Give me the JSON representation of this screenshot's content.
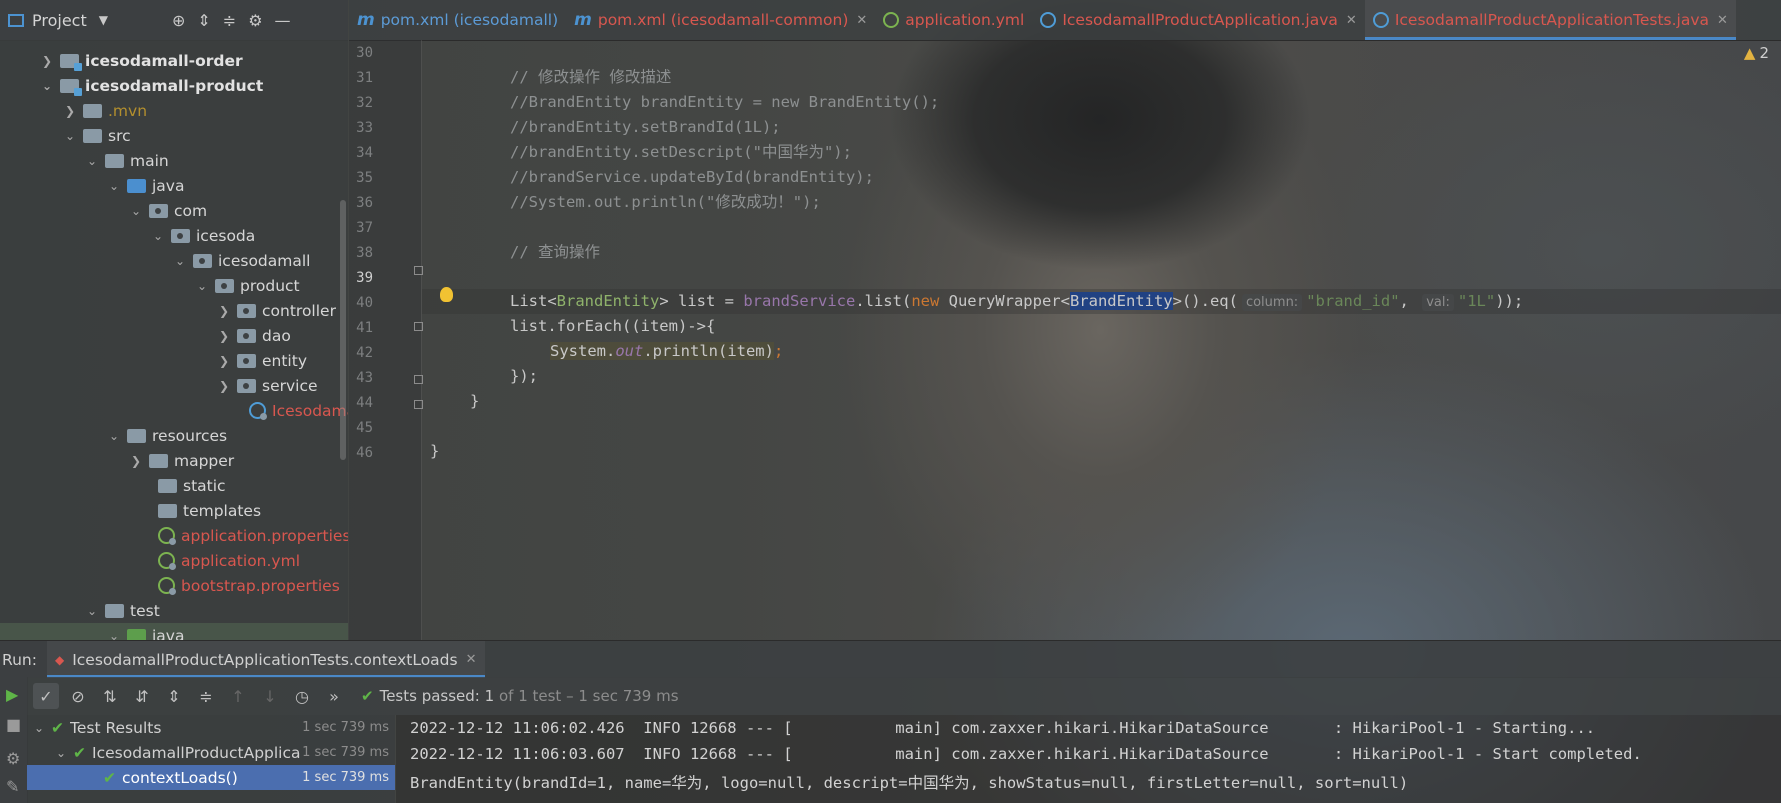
{
  "project_panel": {
    "title": "Project",
    "tree": [
      {
        "label": "icesodamall-order",
        "kind": "module",
        "depth": 0,
        "expanded": false
      },
      {
        "label": "icesodamall-product",
        "kind": "module",
        "depth": 0,
        "expanded": true
      },
      {
        "label": ".mvn",
        "kind": "folder",
        "depth": 1,
        "expanded": false
      },
      {
        "label": "src",
        "kind": "folder",
        "depth": 1,
        "expanded": true
      },
      {
        "label": "main",
        "kind": "folder",
        "depth": 2,
        "expanded": true
      },
      {
        "label": "java",
        "kind": "source-folder",
        "depth": 3,
        "expanded": true
      },
      {
        "label": "com",
        "kind": "package",
        "depth": 4,
        "expanded": true
      },
      {
        "label": "icesoda",
        "kind": "package",
        "depth": 5,
        "expanded": true
      },
      {
        "label": "icesodamall",
        "kind": "package",
        "depth": 6,
        "expanded": true
      },
      {
        "label": "product",
        "kind": "package",
        "depth": 7,
        "expanded": true
      },
      {
        "label": "controller",
        "kind": "package",
        "depth": 8,
        "expanded": false
      },
      {
        "label": "dao",
        "kind": "package",
        "depth": 8,
        "expanded": false
      },
      {
        "label": "entity",
        "kind": "package",
        "depth": 8,
        "expanded": false
      },
      {
        "label": "service",
        "kind": "package",
        "depth": 8,
        "expanded": false
      },
      {
        "label": "Icesodama",
        "kind": "spring-class",
        "depth": 8,
        "expanded": null
      },
      {
        "label": "resources",
        "kind": "resources",
        "depth": 3,
        "expanded": true
      },
      {
        "label": "mapper",
        "kind": "folder",
        "depth": 4,
        "expanded": false
      },
      {
        "label": "static",
        "kind": "folder",
        "depth": 4,
        "expanded": null
      },
      {
        "label": "templates",
        "kind": "folder",
        "depth": 4,
        "expanded": null
      },
      {
        "label": "application.properties",
        "kind": "spring-file",
        "depth": 4,
        "expanded": null
      },
      {
        "label": "application.yml",
        "kind": "spring-file",
        "depth": 4,
        "expanded": null
      },
      {
        "label": "bootstrap.properties",
        "kind": "spring-file",
        "depth": 4,
        "expanded": null
      },
      {
        "label": "test",
        "kind": "folder",
        "depth": 2,
        "expanded": true
      },
      {
        "label": "java",
        "kind": "test-folder",
        "depth": 3,
        "expanded": true
      }
    ]
  },
  "editor_tabs": [
    {
      "label": "pom.xml (icesodamall)",
      "icon": "maven-icon",
      "color": "#5c9bd6",
      "closable": false
    },
    {
      "label": "pom.xml (icesodamall-common)",
      "icon": "maven-icon",
      "color": "#d8574f",
      "closable": true
    },
    {
      "label": "application.yml",
      "icon": "spring-icon",
      "color": "#d8574f",
      "closable": false
    },
    {
      "label": "IcesodamallProductApplication.java",
      "icon": "class-icon",
      "color": "#d8574f",
      "closable": true
    },
    {
      "label": "IcesodamallProductApplicationTests.java",
      "icon": "class-icon",
      "color": "#d8574f",
      "closable": true,
      "active": true
    }
  ],
  "warnings": {
    "count": "2"
  },
  "editor": {
    "current_line": 39,
    "lines": [
      {
        "n": "30"
      },
      {
        "n": "31",
        "text": "// 修改操作 修改描述"
      },
      {
        "n": "32",
        "text": "//BrandEntity brandEntity = new BrandEntity();"
      },
      {
        "n": "33",
        "text": "//brandEntity.setBrandId(1L);"
      },
      {
        "n": "34",
        "text": "//brandEntity.setDescript(\"中国华为\");"
      },
      {
        "n": "35",
        "text": "//brandService.updateById(brandEntity);"
      },
      {
        "n": "36",
        "text": "//System.out.println(\"修改成功！\");"
      },
      {
        "n": "37"
      },
      {
        "n": "38",
        "text": "// 查询操作"
      },
      {
        "n": "39",
        "tokens": {
          "t1": "List<",
          "t2": "BrandEntity",
          "t3": "> list = ",
          "t4": "brandService",
          "t5": ".list(",
          "t6": "new",
          "t7": " QueryWrapper<",
          "t8": "BrandEntity",
          "t9": ">().eq(",
          "hint1": "column:",
          "s1": "\"brand_id\"",
          "t10": ", ",
          "hint2": "val:",
          "s2": "\"1L\"",
          "t11": "));"
        }
      },
      {
        "n": "40",
        "text": "list.forEach((item)->{"
      },
      {
        "n": "41",
        "tokens": {
          "t1": "System.",
          "t2": "out",
          "t3": ".println(item)",
          "t4": ";"
        }
      },
      {
        "n": "42",
        "text": "});"
      },
      {
        "n": "43",
        "text": "}"
      },
      {
        "n": "44"
      },
      {
        "n": "45",
        "text": "}"
      },
      {
        "n": "46"
      }
    ]
  },
  "run_panel": {
    "label": "Run:",
    "tab_label": "IcesodamallProductApplicationTests.contextLoads",
    "status_prefix": "Tests passed:",
    "status_count": "1",
    "status_rest": "of 1 test – 1 sec 739 ms",
    "tests": [
      {
        "label": "Test Results",
        "time": "1 sec 739 ms",
        "depth": 0
      },
      {
        "label": "IcesodamallProductApplica",
        "time": "1 sec 739 ms",
        "depth": 1
      },
      {
        "label": "contextLoads()",
        "time": "1 sec 739 ms",
        "depth": 2,
        "selected": true
      }
    ],
    "console": [
      "2022-12-12 11:06:02.426  INFO 12668 --- [           main] com.zaxxer.hikari.HikariDataSource       : HikariPool-1 - Starting...",
      "2022-12-12 11:06:03.607  INFO 12668 --- [           main] com.zaxxer.hikari.HikariDataSource       : HikariPool-1 - Start completed.",
      "BrandEntity(brandId=1, name=华为, logo=null, descript=中国华为, showStatus=null, firstLetter=null, sort=null)"
    ]
  }
}
